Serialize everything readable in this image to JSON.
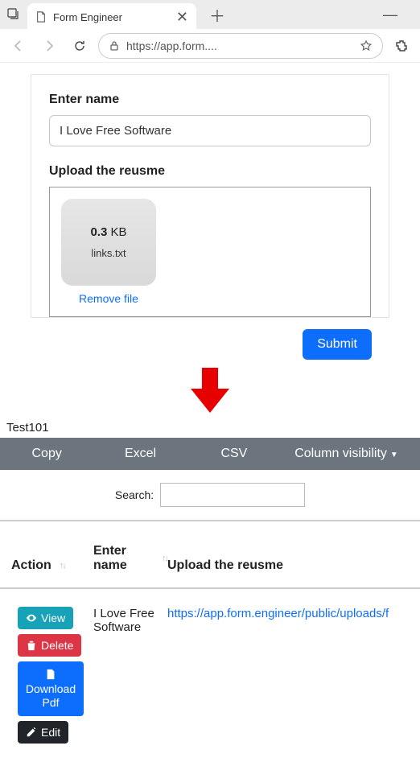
{
  "browser": {
    "tab_title": "Form Engineer",
    "url": "https://app.form....",
    "new_tab": "＋",
    "tab_close": "✕",
    "win_min": "—"
  },
  "form": {
    "name_label": "Enter name",
    "name_value": "I Love Free Software",
    "upload_label": "Upload the reusme",
    "file_size_num": "0.3",
    "file_size_unit": " KB",
    "file_name": "links.txt",
    "remove_label": "Remove file",
    "submit_label": "Submit"
  },
  "table": {
    "title": "Test101",
    "toolbar": {
      "copy": "Copy",
      "excel": "Excel",
      "csv": "CSV",
      "visibility": "Column visibility"
    },
    "search_label": "Search:",
    "search_value": "",
    "headers": {
      "action": "Action",
      "name": "Enter name",
      "upload": "Upload the reusme"
    },
    "row": {
      "name": "I Love Free Software",
      "upload_link": "https://app.form.engineer/public/uploads/f"
    },
    "actions": {
      "view": "View",
      "delete": "Delete",
      "download": "Download Pdf",
      "edit": "Edit"
    }
  }
}
